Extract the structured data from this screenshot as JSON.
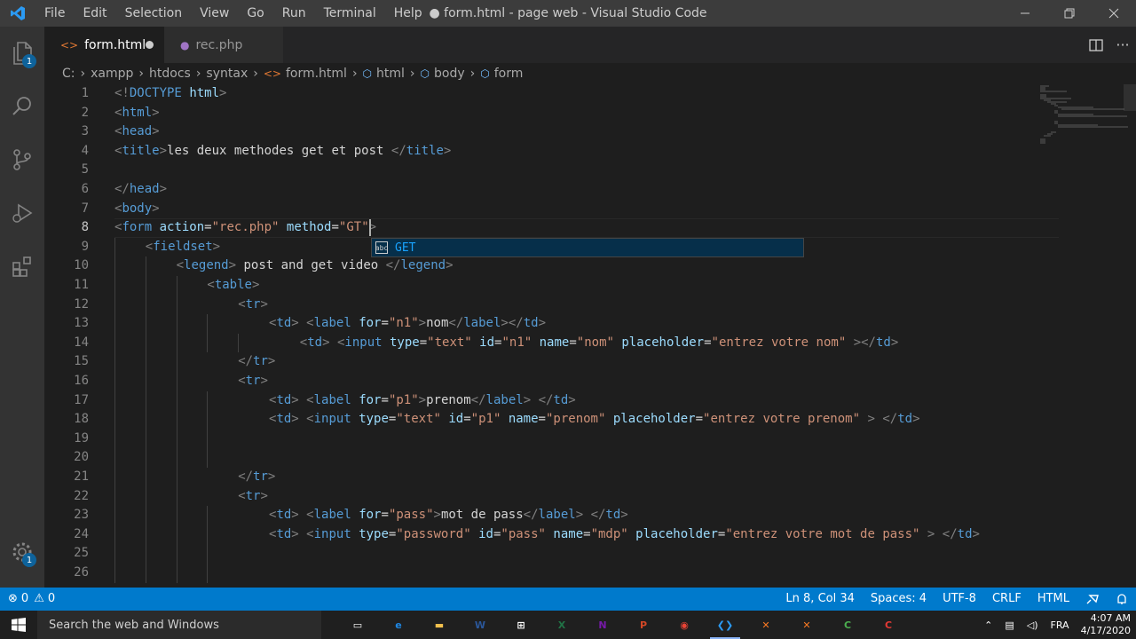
{
  "window": {
    "title": "● form.html - page web - Visual Studio Code",
    "logo": "vscode-logo-icon",
    "controls": [
      "minimize",
      "restore",
      "close"
    ]
  },
  "menu": [
    "File",
    "Edit",
    "Selection",
    "View",
    "Go",
    "Run",
    "Terminal",
    "Help"
  ],
  "activity_bar": {
    "items": [
      {
        "name": "explorer-icon",
        "badge": "1"
      },
      {
        "name": "search-icon"
      },
      {
        "name": "source-control-icon"
      },
      {
        "name": "run-debug-icon"
      },
      {
        "name": "extensions-icon"
      }
    ],
    "settings_badge": "1"
  },
  "tabs": [
    {
      "label": "form.html",
      "icon": "html-file-icon",
      "active": true,
      "dirty": true
    },
    {
      "label": "rec.php",
      "icon": "php-file-icon",
      "active": false,
      "dirty": false
    }
  ],
  "breadcrumb": [
    "C:",
    "xampp",
    "htdocs",
    "syntax",
    "form.html",
    "html",
    "body",
    "form"
  ],
  "editor": {
    "current_line": 8,
    "lines": [
      {
        "n": "1",
        "indent": 0,
        "tokens": [
          [
            "punc",
            "<!"
          ],
          [
            "dt",
            "DOCTYPE"
          ],
          [
            "text",
            " "
          ],
          [
            "attr",
            "html"
          ],
          [
            "punc",
            ">"
          ]
        ]
      },
      {
        "n": "2",
        "indent": 0,
        "tokens": [
          [
            "punc",
            "<"
          ],
          [
            "tag",
            "html"
          ],
          [
            "punc",
            ">"
          ]
        ]
      },
      {
        "n": "3",
        "indent": 0,
        "tokens": [
          [
            "punc",
            "<"
          ],
          [
            "tag",
            "head"
          ],
          [
            "punc",
            ">"
          ]
        ]
      },
      {
        "n": "4",
        "indent": 0,
        "tokens": [
          [
            "punc",
            "<"
          ],
          [
            "tag",
            "title"
          ],
          [
            "punc",
            ">"
          ],
          [
            "text",
            "les deux methodes get et post "
          ],
          [
            "punc",
            "</"
          ],
          [
            "tag",
            "title"
          ],
          [
            "punc",
            ">"
          ]
        ]
      },
      {
        "n": "5",
        "indent": 0,
        "tokens": []
      },
      {
        "n": "6",
        "indent": 0,
        "tokens": [
          [
            "punc",
            "</"
          ],
          [
            "tag",
            "head"
          ],
          [
            "punc",
            ">"
          ]
        ]
      },
      {
        "n": "7",
        "indent": 0,
        "tokens": [
          [
            "punc",
            "<"
          ],
          [
            "tag",
            "body"
          ],
          [
            "punc",
            ">"
          ]
        ]
      },
      {
        "n": "8",
        "indent": 0,
        "tokens": [
          [
            "punc",
            "<"
          ],
          [
            "tag",
            "form"
          ],
          [
            "text",
            " "
          ],
          [
            "attr",
            "action"
          ],
          [
            "text",
            "="
          ],
          [
            "str",
            "\"rec.php\""
          ],
          [
            "text",
            " "
          ],
          [
            "attr",
            "method"
          ],
          [
            "text",
            "="
          ],
          [
            "str",
            "\"GT\""
          ],
          [
            "punc",
            ">"
          ]
        ]
      },
      {
        "n": "9",
        "indent": 1,
        "tokens": [
          [
            "punc",
            "<"
          ],
          [
            "tag",
            "fieldset"
          ],
          [
            "punc",
            ">"
          ]
        ]
      },
      {
        "n": "10",
        "indent": 2,
        "tokens": [
          [
            "punc",
            "<"
          ],
          [
            "tag",
            "legend"
          ],
          [
            "punc",
            ">"
          ],
          [
            "text",
            " post and get video "
          ],
          [
            "punc",
            "</"
          ],
          [
            "tag",
            "legend"
          ],
          [
            "punc",
            ">"
          ]
        ]
      },
      {
        "n": "11",
        "indent": 3,
        "tokens": [
          [
            "punc",
            "<"
          ],
          [
            "tag",
            "table"
          ],
          [
            "punc",
            ">"
          ]
        ]
      },
      {
        "n": "12",
        "indent": 4,
        "tokens": [
          [
            "punc",
            "<"
          ],
          [
            "tag",
            "tr"
          ],
          [
            "punc",
            ">"
          ]
        ]
      },
      {
        "n": "13",
        "indent": 5,
        "tokens": [
          [
            "punc",
            "<"
          ],
          [
            "tag",
            "td"
          ],
          [
            "punc",
            ">"
          ],
          [
            "text",
            " "
          ],
          [
            "punc",
            "<"
          ],
          [
            "tag",
            "label"
          ],
          [
            "text",
            " "
          ],
          [
            "attr",
            "for"
          ],
          [
            "text",
            "="
          ],
          [
            "str",
            "\"n1\""
          ],
          [
            "punc",
            ">"
          ],
          [
            "text",
            "nom"
          ],
          [
            "punc",
            "</"
          ],
          [
            "tag",
            "label"
          ],
          [
            "punc",
            "></"
          ],
          [
            "tag",
            "td"
          ],
          [
            "punc",
            ">"
          ]
        ]
      },
      {
        "n": "14",
        "indent": 6,
        "tokens": [
          [
            "punc",
            "<"
          ],
          [
            "tag",
            "td"
          ],
          [
            "punc",
            ">"
          ],
          [
            "text",
            " "
          ],
          [
            "punc",
            "<"
          ],
          [
            "tag",
            "input"
          ],
          [
            "text",
            " "
          ],
          [
            "attr",
            "type"
          ],
          [
            "text",
            "="
          ],
          [
            "str",
            "\"text\""
          ],
          [
            "text",
            " "
          ],
          [
            "attr",
            "id"
          ],
          [
            "text",
            "="
          ],
          [
            "str",
            "\"n1\""
          ],
          [
            "text",
            " "
          ],
          [
            "attr",
            "name"
          ],
          [
            "text",
            "="
          ],
          [
            "str",
            "\"nom\""
          ],
          [
            "text",
            " "
          ],
          [
            "attr",
            "placeholder"
          ],
          [
            "text",
            "="
          ],
          [
            "str",
            "\"entrez votre nom\""
          ],
          [
            "text",
            " "
          ],
          [
            "punc",
            "></"
          ],
          [
            "tag",
            "td"
          ],
          [
            "punc",
            ">"
          ]
        ]
      },
      {
        "n": "15",
        "indent": 4,
        "tokens": [
          [
            "punc",
            "</"
          ],
          [
            "tag",
            "tr"
          ],
          [
            "punc",
            ">"
          ]
        ]
      },
      {
        "n": "16",
        "indent": 4,
        "tokens": [
          [
            "punc",
            "<"
          ],
          [
            "tag",
            "tr"
          ],
          [
            "punc",
            ">"
          ]
        ]
      },
      {
        "n": "17",
        "indent": 5,
        "tokens": [
          [
            "punc",
            "<"
          ],
          [
            "tag",
            "td"
          ],
          [
            "punc",
            ">"
          ],
          [
            "text",
            " "
          ],
          [
            "punc",
            "<"
          ],
          [
            "tag",
            "label"
          ],
          [
            "text",
            " "
          ],
          [
            "attr",
            "for"
          ],
          [
            "text",
            "="
          ],
          [
            "str",
            "\"p1\""
          ],
          [
            "punc",
            ">"
          ],
          [
            "text",
            "prenom"
          ],
          [
            "punc",
            "</"
          ],
          [
            "tag",
            "label"
          ],
          [
            "punc",
            ">"
          ],
          [
            "text",
            " "
          ],
          [
            "punc",
            "</"
          ],
          [
            "tag",
            "td"
          ],
          [
            "punc",
            ">"
          ]
        ]
      },
      {
        "n": "18",
        "indent": 5,
        "tokens": [
          [
            "punc",
            "<"
          ],
          [
            "tag",
            "td"
          ],
          [
            "punc",
            ">"
          ],
          [
            "text",
            " "
          ],
          [
            "punc",
            "<"
          ],
          [
            "tag",
            "input"
          ],
          [
            "text",
            " "
          ],
          [
            "attr",
            "type"
          ],
          [
            "text",
            "="
          ],
          [
            "str",
            "\"text\""
          ],
          [
            "text",
            " "
          ],
          [
            "attr",
            "id"
          ],
          [
            "text",
            "="
          ],
          [
            "str",
            "\"p1\""
          ],
          [
            "text",
            " "
          ],
          [
            "attr",
            "name"
          ],
          [
            "text",
            "="
          ],
          [
            "str",
            "\"prenom\""
          ],
          [
            "text",
            " "
          ],
          [
            "attr",
            "placeholder"
          ],
          [
            "text",
            "="
          ],
          [
            "str",
            "\"entrez votre prenom\""
          ],
          [
            "text",
            " "
          ],
          [
            "punc",
            ">"
          ],
          [
            "text",
            " "
          ],
          [
            "punc",
            "</"
          ],
          [
            "tag",
            "td"
          ],
          [
            "punc",
            ">"
          ]
        ]
      },
      {
        "n": "19",
        "indent": 0,
        "tokens": []
      },
      {
        "n": "20",
        "indent": 0,
        "tokens": []
      },
      {
        "n": "21",
        "indent": 4,
        "tokens": [
          [
            "punc",
            "</"
          ],
          [
            "tag",
            "tr"
          ],
          [
            "punc",
            ">"
          ]
        ]
      },
      {
        "n": "22",
        "indent": 4,
        "tokens": [
          [
            "punc",
            "<"
          ],
          [
            "tag",
            "tr"
          ],
          [
            "punc",
            ">"
          ]
        ]
      },
      {
        "n": "23",
        "indent": 5,
        "tokens": [
          [
            "punc",
            "<"
          ],
          [
            "tag",
            "td"
          ],
          [
            "punc",
            ">"
          ],
          [
            "text",
            " "
          ],
          [
            "punc",
            "<"
          ],
          [
            "tag",
            "label"
          ],
          [
            "text",
            " "
          ],
          [
            "attr",
            "for"
          ],
          [
            "text",
            "="
          ],
          [
            "str",
            "\"pass\""
          ],
          [
            "punc",
            ">"
          ],
          [
            "text",
            "mot de pass"
          ],
          [
            "punc",
            "</"
          ],
          [
            "tag",
            "label"
          ],
          [
            "punc",
            ">"
          ],
          [
            "text",
            " "
          ],
          [
            "punc",
            "</"
          ],
          [
            "tag",
            "td"
          ],
          [
            "punc",
            ">"
          ]
        ]
      },
      {
        "n": "24",
        "indent": 5,
        "tokens": [
          [
            "punc",
            "<"
          ],
          [
            "tag",
            "td"
          ],
          [
            "punc",
            ">"
          ],
          [
            "text",
            " "
          ],
          [
            "punc",
            "<"
          ],
          [
            "tag",
            "input"
          ],
          [
            "text",
            " "
          ],
          [
            "attr",
            "type"
          ],
          [
            "text",
            "="
          ],
          [
            "str",
            "\"password\""
          ],
          [
            "text",
            " "
          ],
          [
            "attr",
            "id"
          ],
          [
            "text",
            "="
          ],
          [
            "str",
            "\"pass\""
          ],
          [
            "text",
            " "
          ],
          [
            "attr",
            "name"
          ],
          [
            "text",
            "="
          ],
          [
            "str",
            "\"mdp\""
          ],
          [
            "text",
            " "
          ],
          [
            "attr",
            "placeholder"
          ],
          [
            "text",
            "="
          ],
          [
            "str",
            "\"entrez votre mot de pass\""
          ],
          [
            "text",
            " "
          ],
          [
            "punc",
            ">"
          ],
          [
            "text",
            " "
          ],
          [
            "punc",
            "</"
          ],
          [
            "tag",
            "td"
          ],
          [
            "punc",
            ">"
          ]
        ]
      },
      {
        "n": "25",
        "indent": 0,
        "tokens": []
      },
      {
        "n": "26",
        "indent": 0,
        "tokens": []
      }
    ],
    "suggestion": {
      "label": "GET",
      "icon": "text-icon"
    }
  },
  "status_bar": {
    "errors": "0",
    "warnings": "0",
    "position": "Ln 8, Col 34",
    "spaces": "Spaces: 4",
    "encoding": "UTF-8",
    "eol": "CRLF",
    "language": "HTML"
  },
  "taskbar": {
    "search_placeholder": "Search the web and Windows",
    "apps": [
      {
        "name": "task-view-icon",
        "glyph": "▭",
        "color": "#ffffff"
      },
      {
        "name": "edge-icon",
        "glyph": "e",
        "color": "#1e88e5"
      },
      {
        "name": "file-explorer-icon",
        "glyph": "▬",
        "color": "#f2c14e"
      },
      {
        "name": "word-icon",
        "glyph": "W",
        "color": "#2b579a"
      },
      {
        "name": "store-icon",
        "glyph": "⊞",
        "color": "#ffffff"
      },
      {
        "name": "excel-icon",
        "glyph": "X",
        "color": "#217346"
      },
      {
        "name": "onenote-icon",
        "glyph": "N",
        "color": "#7719aa"
      },
      {
        "name": "powerpoint-icon",
        "glyph": "P",
        "color": "#d24726"
      },
      {
        "name": "chrome-icon",
        "glyph": "◉",
        "color": "#ea4335"
      },
      {
        "name": "vscode-icon",
        "glyph": "❮❯",
        "color": "#2b9af3",
        "active": true
      },
      {
        "name": "xampp-icon",
        "glyph": "✕",
        "color": "#fb7a24"
      },
      {
        "name": "xampp-icon-2",
        "glyph": "✕",
        "color": "#fb7a24"
      },
      {
        "name": "camtasia-icon",
        "glyph": "C",
        "color": "#4caf50"
      },
      {
        "name": "camtasia-recorder-icon",
        "glyph": "C",
        "color": "#e53935"
      }
    ],
    "lang": "FRA",
    "time": "4:07 AM",
    "date": "4/17/2020"
  }
}
